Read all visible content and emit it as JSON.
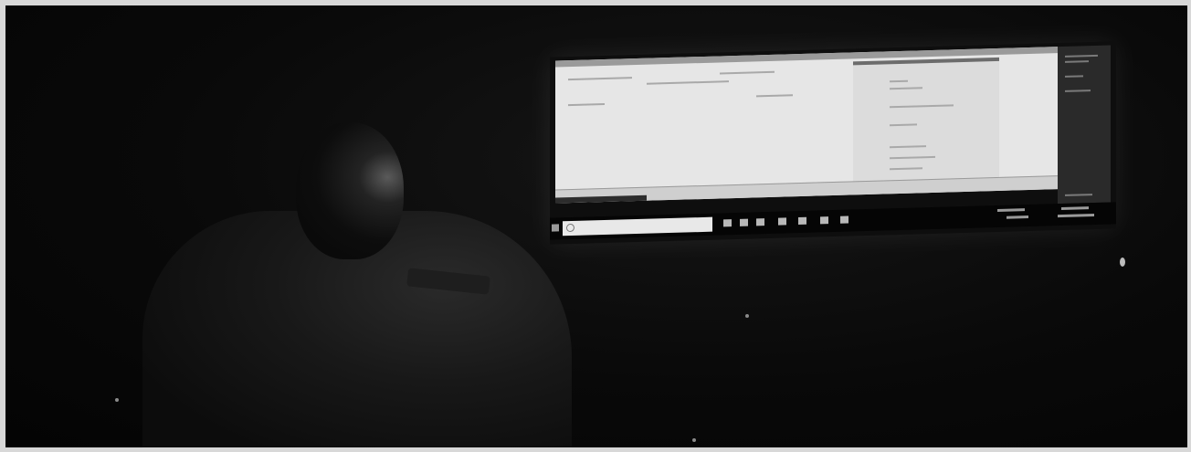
{
  "scene": {
    "description_kind": "photo",
    "subject": "person",
    "background_color": "#050505",
    "screen_color": "#e6e6e6"
  },
  "monitor": {
    "taskbar": {
      "search_placeholder": "",
      "clock": ""
    }
  }
}
